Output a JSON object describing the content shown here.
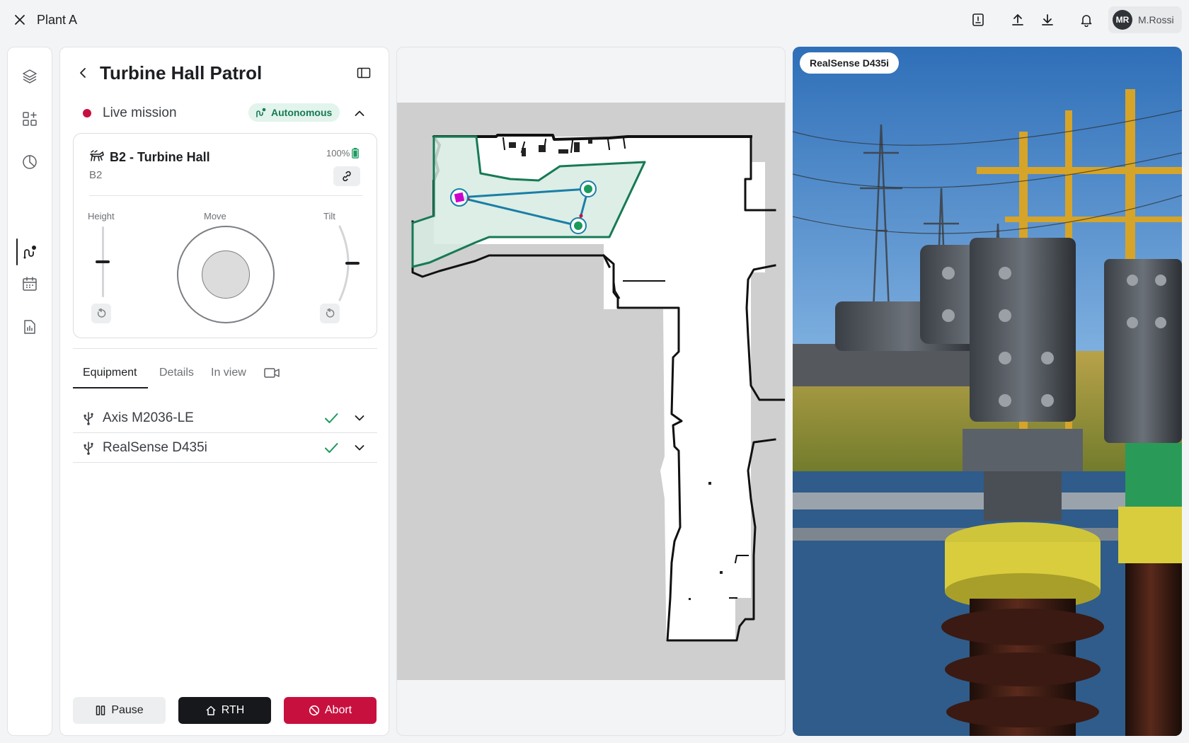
{
  "app": {
    "title": "Plant A",
    "user": {
      "initials": "MR",
      "name": "M.Rossi"
    }
  },
  "topbar": {
    "icons": [
      "report-icon",
      "upload-icon",
      "download-icon",
      "bell-icon"
    ]
  },
  "rail": {
    "items": [
      "layers-icon",
      "widgets-icon",
      "analytics-icon",
      "mission-route-icon",
      "calendar-icon",
      "report-chart-icon"
    ],
    "active_index": 3
  },
  "mission": {
    "title": "Turbine Hall Patrol",
    "status": "Live mission",
    "mode": "Autonomous",
    "robot": {
      "name": "B2 - Turbine Hall",
      "id": "B2",
      "battery": "100%"
    },
    "controls": {
      "height_label": "Height",
      "move_label": "Move",
      "tilt_label": "Tilt",
      "height_level": 0.5,
      "tilt_level": 0.5
    },
    "tabs": [
      "Equipment",
      "Details",
      "In view"
    ],
    "active_tab": 0,
    "equipment": [
      {
        "name": "Axis M2036-LE",
        "status": "ok"
      },
      {
        "name": "RealSense D435i",
        "status": "ok"
      }
    ],
    "actions": {
      "pause": "Pause",
      "rth": "RTH",
      "abort": "Abort"
    }
  },
  "camera": {
    "label": "RealSense D435i"
  },
  "colors": {
    "accent_green": "#177a55",
    "danger": "#c8103e",
    "route": "#1a7ea6",
    "zone_fill": "#d6ebe2",
    "robot_marker": "#cc00cc"
  }
}
